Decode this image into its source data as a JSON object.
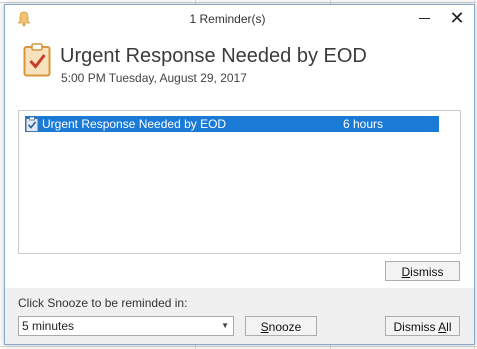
{
  "window": {
    "title": "1 Reminder(s)",
    "close_glyph": "✕"
  },
  "header": {
    "subject": "Urgent Response Needed by EOD",
    "due": "5:00 PM Tuesday, August 29, 2017",
    "icon": "task-clipboard-icon"
  },
  "reminders": [
    {
      "subject": "Urgent Response Needed by EOD",
      "due_in": "6 hours",
      "icon": "task-clipboard-icon"
    }
  ],
  "buttons": {
    "dismiss": {
      "mnemonic": "D",
      "rest": "ismiss"
    },
    "snooze": {
      "mnemonic": "S",
      "rest": "nooze"
    },
    "dismiss_all": {
      "prefix": "Dismiss ",
      "mnemonic": "A",
      "rest": "ll"
    }
  },
  "snooze": {
    "label": "Click Snooze to be reminded in:",
    "selected": "5 minutes"
  },
  "colors": {
    "selection": "#1a7ad6",
    "icon_orange": "#e0a04a",
    "icon_check": "#c9402a"
  }
}
